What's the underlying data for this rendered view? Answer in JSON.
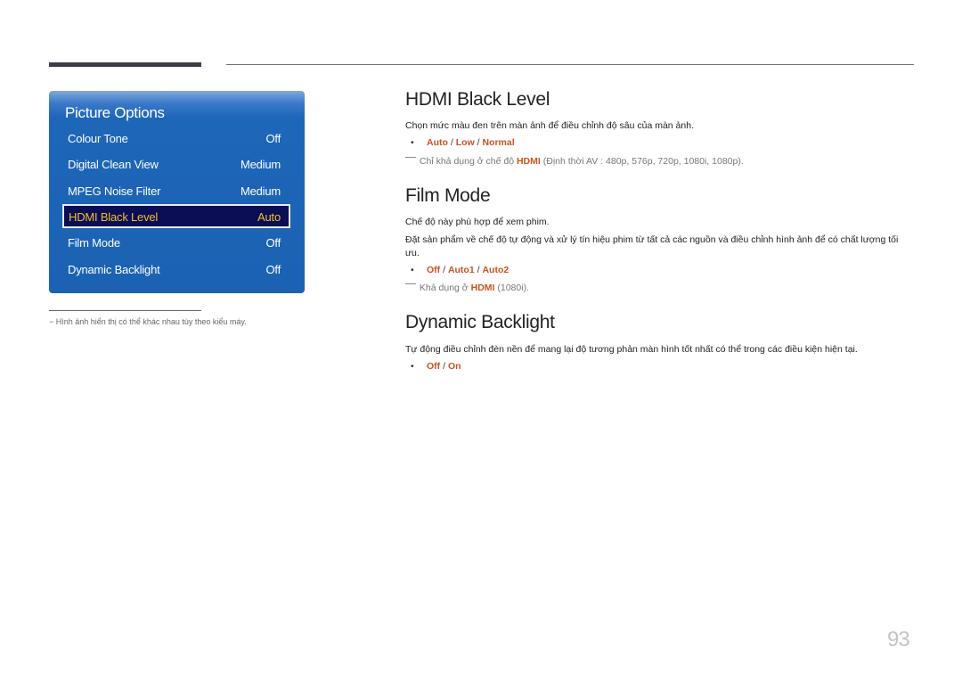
{
  "panel": {
    "title": "Picture Options",
    "items": [
      {
        "label": "Colour Tone",
        "value": "Off"
      },
      {
        "label": "Digital Clean View",
        "value": "Medium"
      },
      {
        "label": "MPEG Noise Filter",
        "value": "Medium"
      },
      {
        "label": "HDMI Black Level",
        "value": "Auto",
        "selected": true
      },
      {
        "label": "Film Mode",
        "value": "Off"
      },
      {
        "label": "Dynamic Backlight",
        "value": "Off"
      }
    ],
    "colors": {
      "panel": "#1b62b3",
      "selected_bg": "#0b0d55",
      "selected_text": "#f2c02c"
    }
  },
  "footnote": "−  Hình ảnh hiển thị có thể khác nhau tùy theo kiểu máy.",
  "sections": [
    {
      "title": "HDMI Black Level",
      "paragraphs": [
        "Chọn mức màu đen trên màn ảnh để điều chỉnh độ sâu của màn ảnh."
      ],
      "bullet": "•",
      "options": [
        "Auto",
        "Low",
        "Normal"
      ],
      "note": {
        "prefix": "Chỉ khả dụng ở chế độ",
        "highlight": "HDMI",
        "suffix": "(Định thời AV : 480p, 576p, 720p, 1080i, 1080p)."
      }
    },
    {
      "title": "Film Mode",
      "paragraphs": [
        "Chế độ này phù hợp để xem phim.",
        "Đặt sản phẩm về chế độ tự động và xử lý tín hiệu phim từ tất cả các nguồn và điều chỉnh hình ảnh để có chất lượng tối ưu."
      ],
      "bullet": "•",
      "options": [
        "Off",
        "Auto1",
        "Auto2"
      ],
      "note": {
        "prefix": "Khả dụng ở",
        "highlight": "HDMI",
        "suffix": "(1080i)."
      }
    },
    {
      "title": "Dynamic Backlight",
      "paragraphs": [
        "Tự động điều chỉnh đèn nền để mang lại độ tương phản màn hình tốt nhất có thể trong các điều kiện hiện tại."
      ],
      "bullet": "•",
      "options": [
        "Off",
        "On"
      ]
    }
  ],
  "separator": "/",
  "accent_color": "#c8531f",
  "page_number": "93"
}
